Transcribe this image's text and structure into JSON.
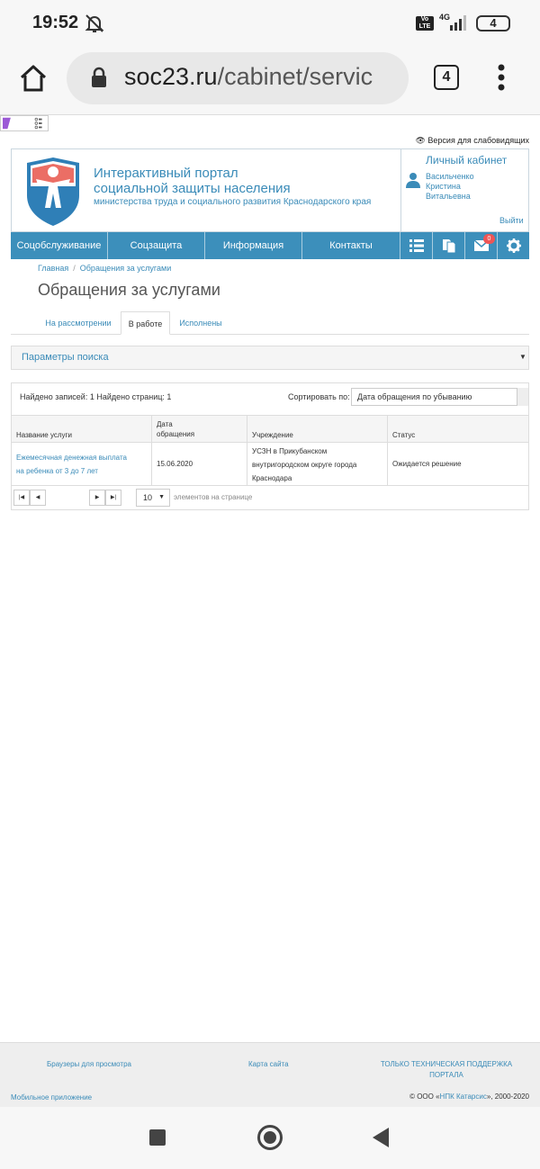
{
  "status": {
    "time": "19:52",
    "volte": "Vo LTE",
    "network": "4G",
    "battery": "4"
  },
  "browser": {
    "url_domain": "soc23.ru",
    "url_path": "/cabinet/servic",
    "tab_count": "4"
  },
  "accessibility": {
    "label": "Версия для слабовидящих"
  },
  "header": {
    "title_line1": "Интерактивный портал",
    "title_line2": "социальной защиты населения",
    "subtitle": "министерства труда и социального развития Краснодарского края"
  },
  "cabinet": {
    "title": "Личный кабинет",
    "name_line1": "Васильченко",
    "name_line2": "Кристина",
    "name_line3": "Витальевна",
    "logout": "Выйти"
  },
  "nav": {
    "items": [
      "Соцобслуживание",
      "Соцзащита",
      "Информация",
      "Контакты"
    ],
    "badge": "0"
  },
  "breadcrumb": {
    "home": "Главная",
    "current": "Обращения за услугами"
  },
  "page": {
    "title": "Обращения за услугами"
  },
  "tabs": [
    "На рассмотрении",
    "В работе",
    "Исполнены"
  ],
  "search": {
    "label": "Параметры поиска"
  },
  "results": {
    "found": "Найдено записей: 1 Найдено страниц: 1",
    "sort_label": "Сортировать по:",
    "sort_value": "Дата обращения по убыванию",
    "columns": [
      "Название услуги",
      "Дата обращения",
      "Учреждение",
      "Статус"
    ],
    "column_date_line1": "Дата",
    "column_date_line2": "обращения",
    "row": {
      "service_line1": "Ежемесячная денежная выплата",
      "service_line2": "на ребенка от 3 до 7 лет",
      "date": "15.06.2020",
      "institution_line1": "УСЗН в Прикубанском",
      "institution_line2": "внутригородском округе города",
      "institution_line3": "Краснодара",
      "status": "Ожидается решение"
    },
    "per_page": "10",
    "per_page_label": "элементов на странице"
  },
  "footer": {
    "browsers": "Браузеры для просмотра",
    "sitemap": "Карта сайта",
    "support_line1": "ТОЛЬКО ТЕХНИЧЕСКАЯ ПОДДЕРЖКА",
    "support_line2": "ПОРТАЛА",
    "mobile": "Мобильное приложение",
    "copyright_prefix": "© ООО «",
    "copyright_company": "НПК Катарсис",
    "copyright_suffix": "», 2000-2020"
  }
}
